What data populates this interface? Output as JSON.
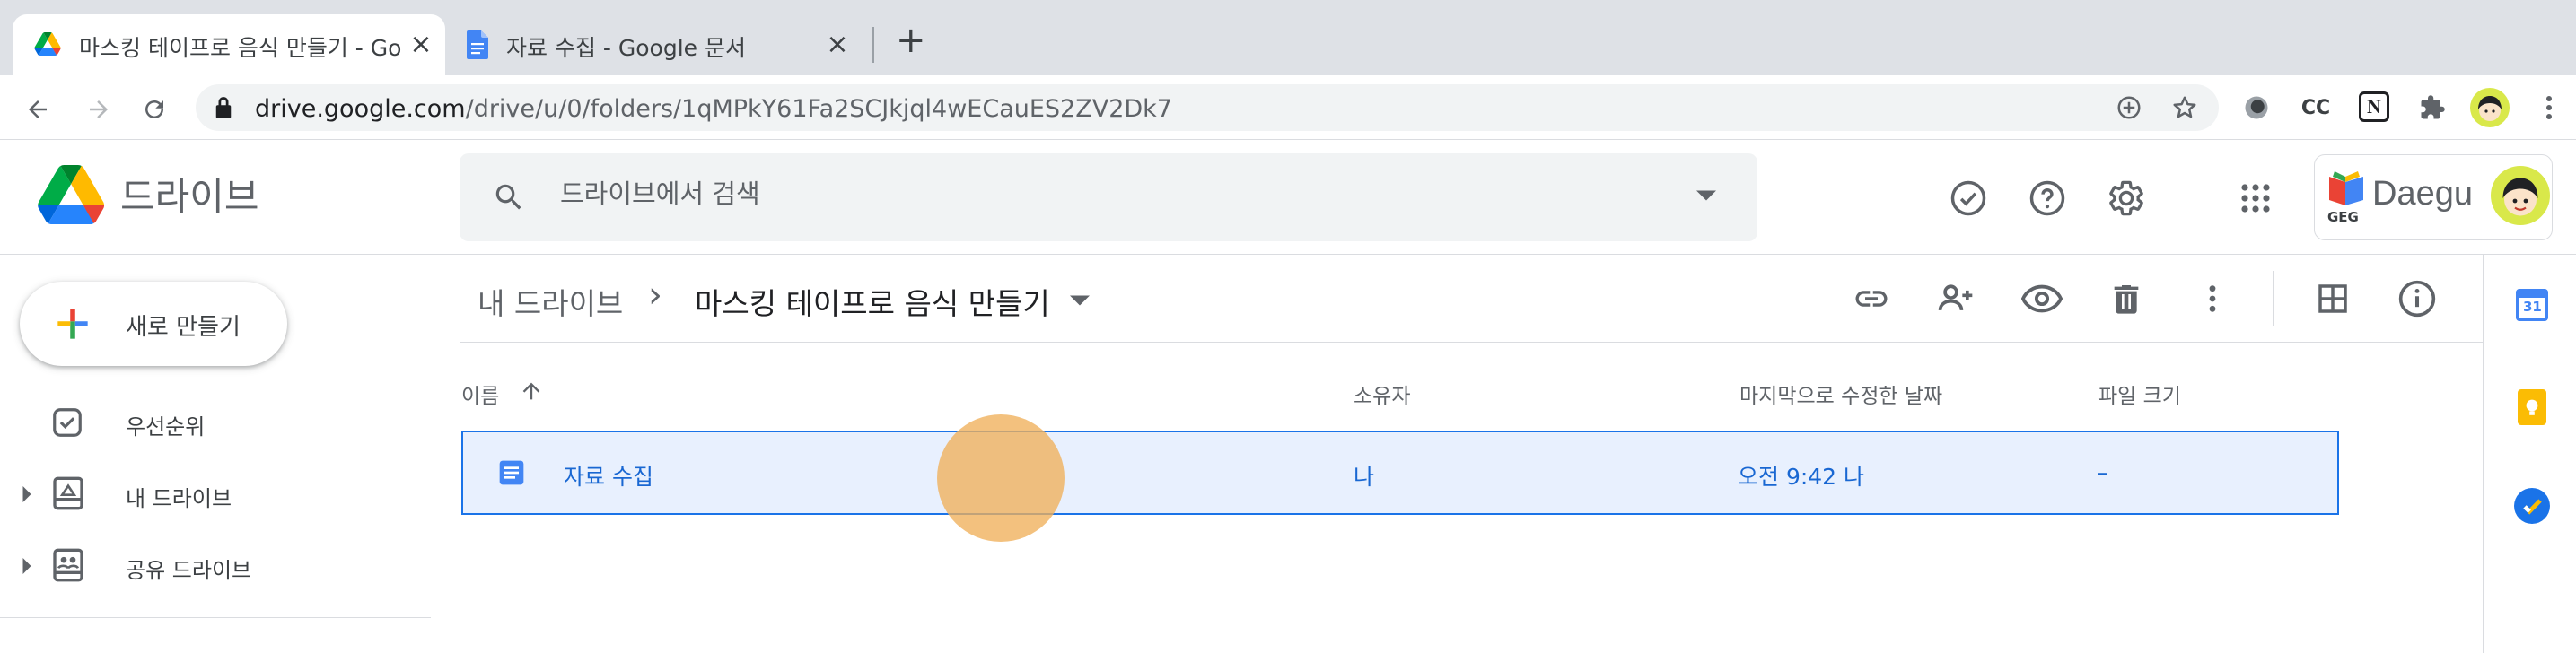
{
  "browser": {
    "tabs": [
      {
        "title": "마스킹 테이프로 음식 만들기 - Goog",
        "active": true,
        "icon": "google-drive-icon"
      },
      {
        "title": "자료 수집 - Google 문서",
        "active": false,
        "icon": "google-docs-icon"
      }
    ],
    "new_tab_label": "+",
    "close_label": "×",
    "url_host": "drive.google.com",
    "url_path": "/drive/u/0/folders/1qMPkY61Fa2SCJkjql4wECauES2ZV2Dk7",
    "extension_cc_label": "CC",
    "extension_notion_label": "N"
  },
  "drive": {
    "brand_label": "드라이브",
    "search_placeholder": "드라이브에서 검색",
    "org_name": "Daegu",
    "org_logo_label": "GEG",
    "new_button_label": "새로 만들기",
    "nav": [
      {
        "label": "우선순위",
        "icon": "priority-check-icon"
      },
      {
        "label": "내 드라이브",
        "icon": "my-drive-icon"
      },
      {
        "label": "공유 드라이브",
        "icon": "shared-drives-icon"
      }
    ],
    "breadcrumb": {
      "root": "내 드라이브",
      "separator": "›",
      "current": "마스킹 테이프로 음식 만들기"
    },
    "columns": {
      "name": "이름",
      "owner": "소유자",
      "modified": "마지막으로 수정한 날짜",
      "size": "파일 크기"
    },
    "files": [
      {
        "name": "자료 수집",
        "owner": "나",
        "modified": "오전 9:42 나",
        "size": "–",
        "selected": true
      }
    ],
    "side_panel": {
      "calendar_day": "31"
    }
  },
  "colors": {
    "accent": "#1a73e8",
    "selection_bg": "#e8f0fe",
    "cursor_highlight": "#f0b05a"
  }
}
